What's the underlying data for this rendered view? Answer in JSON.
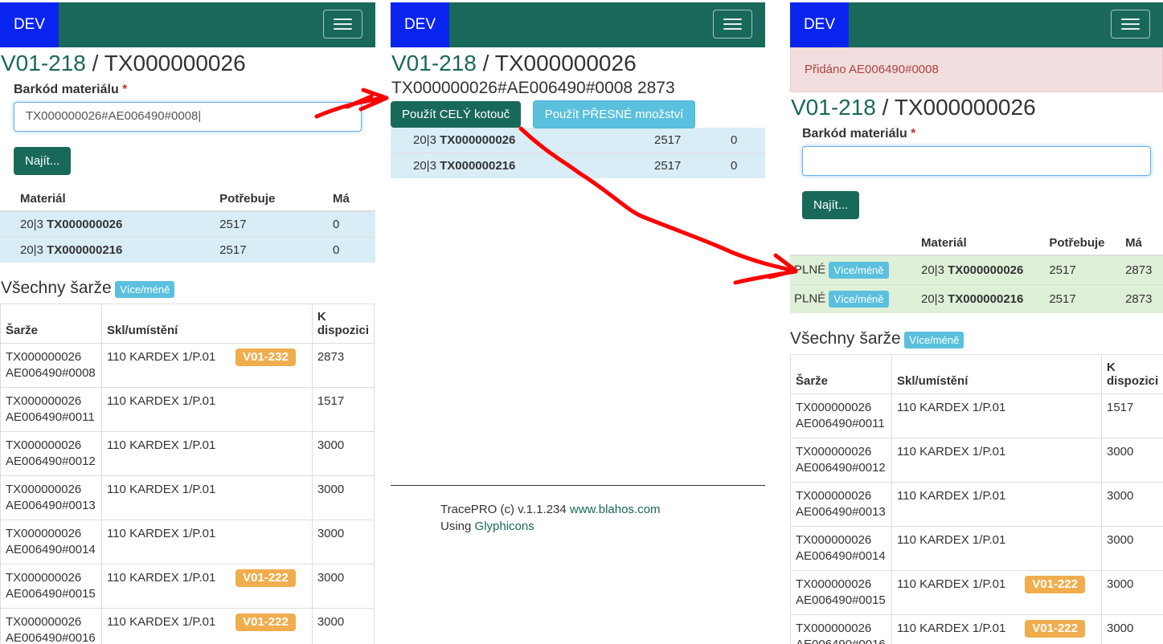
{
  "nav": {
    "dev_label": "DEV"
  },
  "title": {
    "order": "V01-218",
    "sep": " / ",
    "item": "TX000000026"
  },
  "form": {
    "barcode_label": "Barkód materiálu",
    "required_mark": "*",
    "find_button": "Najít..."
  },
  "materials": {
    "headers": [
      "Materiál",
      "Potřebuje",
      "Má"
    ],
    "rows": [
      {
        "prefix": "20|3 ",
        "code": "TX000000026",
        "need": "2517",
        "has": "0"
      },
      {
        "prefix": "20|3 ",
        "code": "TX000000216",
        "need": "2517",
        "has": "0"
      }
    ]
  },
  "batches": {
    "title": "Všechny šarže",
    "toggle": "Více/méně",
    "headers": [
      "Šarže",
      "Skl/umístění",
      "K",
      "dispozici"
    ]
  },
  "panel1": {
    "input_value": "TX000000026#AE006490#0008",
    "batch_rows": [
      {
        "line1": "TX000000026",
        "line2": "AE006490#0008",
        "loc": "110 KARDEX 1/P.01",
        "tag": "V01-232",
        "qty": "2873"
      },
      {
        "line1": "TX000000026",
        "line2": "AE006490#0011",
        "loc": "110 KARDEX 1/P.01",
        "tag": "",
        "qty": "1517"
      },
      {
        "line1": "TX000000026",
        "line2": "AE006490#0012",
        "loc": "110 KARDEX 1/P.01",
        "tag": "",
        "qty": "3000"
      },
      {
        "line1": "TX000000026",
        "line2": "AE006490#0013",
        "loc": "110 KARDEX 1/P.01",
        "tag": "",
        "qty": "3000"
      },
      {
        "line1": "TX000000026",
        "line2": "AE006490#0014",
        "loc": "110 KARDEX 1/P.01",
        "tag": "",
        "qty": "3000"
      },
      {
        "line1": "TX000000026",
        "line2": "AE006490#0015",
        "loc": "110 KARDEX 1/P.01",
        "tag": "V01-222",
        "qty": "3000"
      },
      {
        "line1": "TX000000026",
        "line2": "AE006490#0016",
        "loc": "110 KARDEX 1/P.01",
        "tag": "V01-222",
        "qty": "3000"
      }
    ]
  },
  "panel2": {
    "scanned": "TX000000026#AE006490#0008 2873",
    "use_whole": "Použít CELÝ kotouč",
    "use_exact": "Použít PŘESNÉ množství",
    "footer_text": "TracePRO (c) v.1.1.234 ",
    "footer_link": "www.blahos.com",
    "using_text": "Using ",
    "using_link": "Glyphicons"
  },
  "panel3": {
    "alert": "Přidáno AE006490#0008",
    "status_full": "PLNÉ",
    "mat_has": [
      "2873",
      "2873"
    ],
    "batch_rows": [
      {
        "line1": "TX000000026",
        "line2": "AE006490#0011",
        "loc": "110 KARDEX 1/P.01",
        "tag": "",
        "qty": "1517"
      },
      {
        "line1": "TX000000026",
        "line2": "AE006490#0012",
        "loc": "110 KARDEX 1/P.01",
        "tag": "",
        "qty": "3000"
      },
      {
        "line1": "TX000000026",
        "line2": "AE006490#0013",
        "loc": "110 KARDEX 1/P.01",
        "tag": "",
        "qty": "3000"
      },
      {
        "line1": "TX000000026",
        "line2": "AE006490#0014",
        "loc": "110 KARDEX 1/P.01",
        "tag": "",
        "qty": "3000"
      },
      {
        "line1": "TX000000026",
        "line2": "AE006490#0015",
        "loc": "110 KARDEX 1/P.01",
        "tag": "V01-222",
        "qty": "3000"
      },
      {
        "line1": "TX000000026",
        "line2": "AE006490#0016",
        "loc": "110 KARDEX 1/P.01",
        "tag": "V01-222",
        "qty": "3000"
      }
    ]
  },
  "colors": {
    "brand": "#19695a",
    "dev": "#0a24f0",
    "info": "#5bc0de",
    "warning": "#f0ad4e",
    "arrow": "#ff0000"
  }
}
